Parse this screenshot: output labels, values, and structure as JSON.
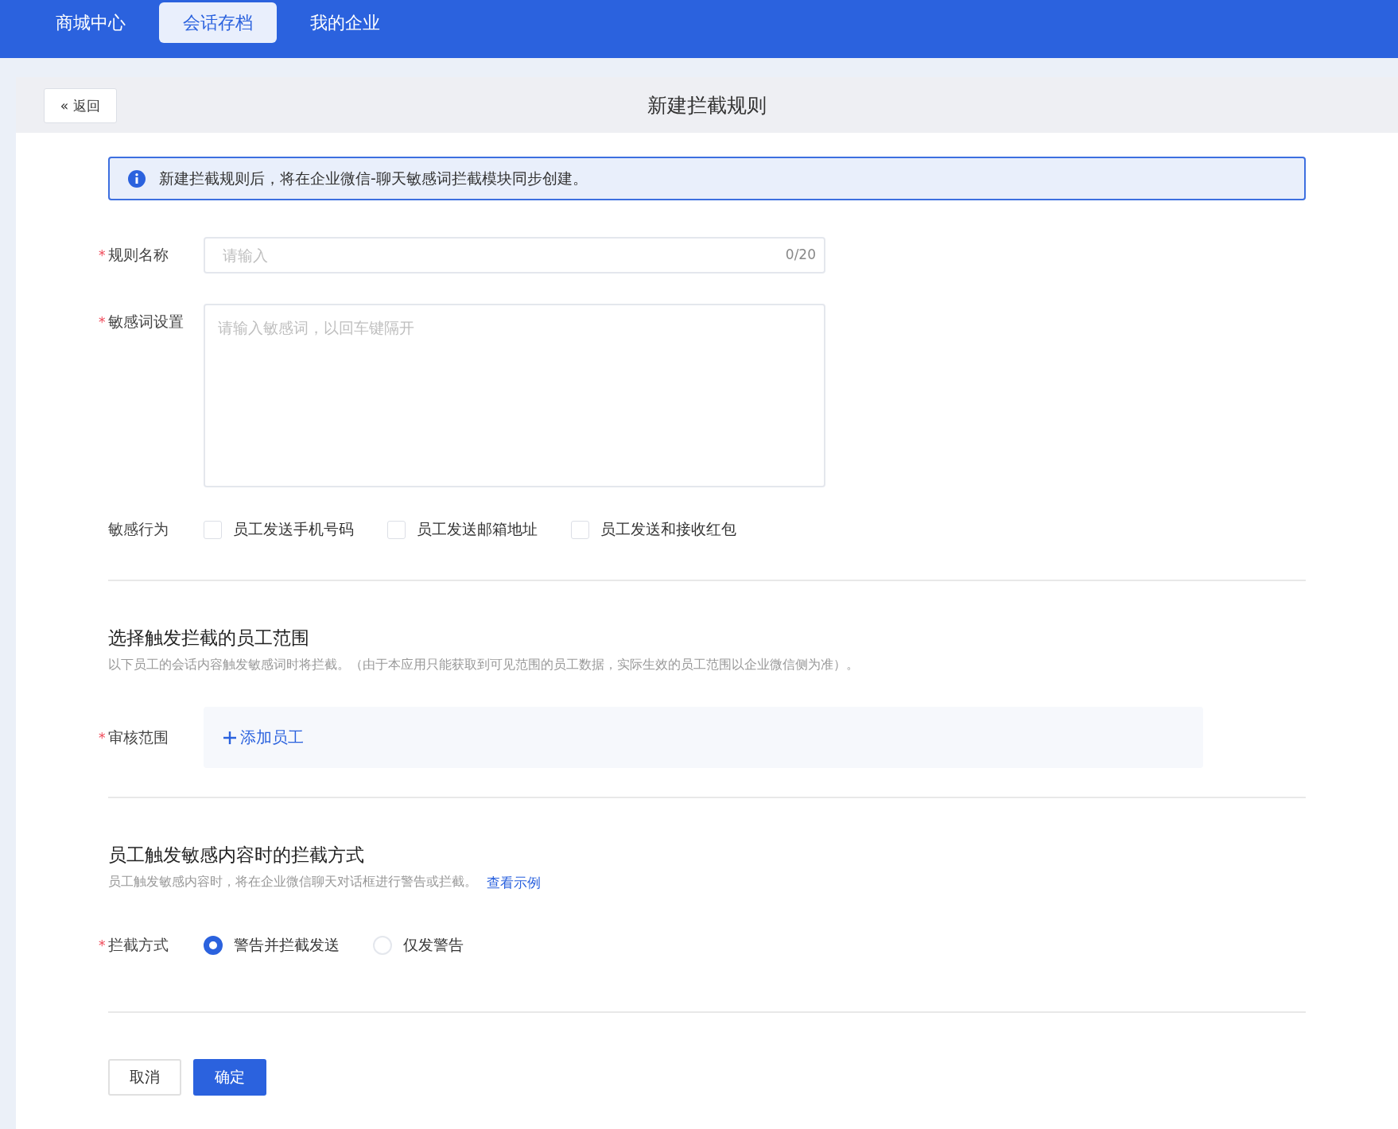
{
  "nav": {
    "tabs": [
      {
        "label": "商城中心",
        "selected": false
      },
      {
        "label": "会话存档",
        "selected": true
      },
      {
        "label": "我的企业",
        "selected": false
      }
    ]
  },
  "header": {
    "back_icon": "«",
    "back_label": "返回",
    "title": "新建拦截规则"
  },
  "alert": {
    "text": "新建拦截规则后，将在企业微信-聊天敏感词拦截模块同步创建。"
  },
  "form": {
    "rule_name": {
      "label": "规则名称",
      "required_mark": "*",
      "placeholder": "请输入",
      "counter": "0/20"
    },
    "keywords": {
      "label": "敏感词设置",
      "required_mark": "*",
      "placeholder": "请输入敏感词，以回车键隔开"
    },
    "behaviors": {
      "label": "敏感行为",
      "options": [
        {
          "label": "员工发送手机号码",
          "checked": false
        },
        {
          "label": "员工发送邮箱地址",
          "checked": false
        },
        {
          "label": "员工发送和接收红包",
          "checked": false
        }
      ]
    }
  },
  "scope_section": {
    "title": "选择触发拦截的员工范围",
    "description": "以下员工的会话内容触发敏感词时将拦截。（由于本应用只能获取到可见范围的员工数据，实际生效的员工范围以企业微信侧为准）。",
    "field": {
      "label": "审核范围",
      "required_mark": "*",
      "add_button": "添加员工"
    }
  },
  "method_section": {
    "title": "员工触发敏感内容时的拦截方式",
    "description": "员工触发敏感内容时，将在企业微信聊天对话框进行警告或拦截。",
    "link": "查看示例",
    "field": {
      "label": "拦截方式",
      "required_mark": "*",
      "options": [
        {
          "label": "警告并拦截发送",
          "selected": true
        },
        {
          "label": "仅发警告",
          "selected": false
        }
      ]
    }
  },
  "buttons": [
    {
      "label": "取消",
      "kind": "secondary"
    },
    {
      "label": "确定",
      "kind": "primary"
    }
  ]
}
